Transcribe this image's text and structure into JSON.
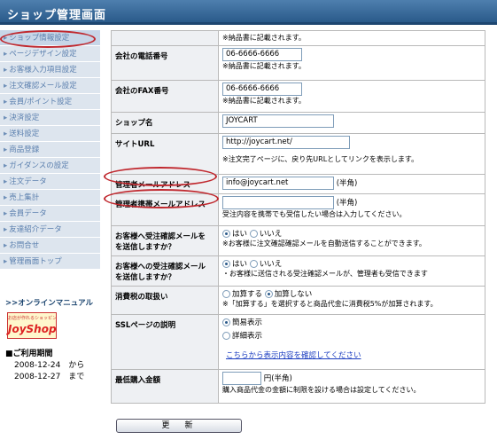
{
  "header": {
    "title": "ショップ管理画面"
  },
  "sidebar": {
    "items": [
      "ショップ情報設定",
      "ページデザイン設定",
      "お客様入力項目設定",
      "注文確認メール設定",
      "会員/ポイント設定",
      "決済設定",
      "送料設定",
      "商品登録",
      "ガイダンスの設定",
      "注文データ",
      "売上集計",
      "会員データ",
      "友達紹介データ",
      "お問合せ",
      "管理画面トップ"
    ]
  },
  "manual_link": ">>オンラインマニュアル",
  "logo": {
    "top": "お店が作れるショッピング",
    "main": "JoyShop"
  },
  "period": {
    "title": "■ご利用期間",
    "row1": "2008-12-24　から",
    "row2": "2008-12-27　まで"
  },
  "form": {
    "note_top": "※納品書に記載されます。",
    "phone": {
      "label": "会社の電話番号",
      "value": "06-6666-6666",
      "note": "※納品書に記載されます。"
    },
    "fax": {
      "label": "会社のFAX番号",
      "value": "06-6666-6666",
      "note": "※納品書に記載されます。"
    },
    "shop_name": {
      "label": "ショップ名",
      "value": "JOYCART"
    },
    "site_url": {
      "label": "サイトURL",
      "value": "http://joycart.net/",
      "note": "※注文完了ページに、戻り先URLとしてリンクを表示します。"
    },
    "admin_email": {
      "label": "管理者メールアドレス",
      "value": "info@joycart.net",
      "suffix": "(半角)"
    },
    "admin_mobile": {
      "label": "管理者携帯メールアドレス",
      "value": "",
      "suffix": "(半角)",
      "note": "受注内容を携帯でも受信したい場合は入力してください。"
    },
    "order_confirm": {
      "label1": "お客様へ受注確認メールを",
      "label2": "を送信しますか？",
      "yes": "はい",
      "no": "いいえ",
      "note": "※お客様に注文確認確認メールを自動送信することができます。"
    },
    "order_confirm2": {
      "label1": "お客様への受注確認メール",
      "label2": "を送信しますか？",
      "yes": "はい",
      "no": "いいえ",
      "note": "・お客様に送信される受注確認メールが、管理者も受信できます"
    },
    "tax": {
      "label": "消費税の取扱い",
      "opt1": "加算する",
      "opt2": "加算しない",
      "note": "※「加算する」を選択すると商品代金に消費税5%が加算されます。"
    },
    "ssl": {
      "label": "SSLページの説明",
      "opt1": "簡易表示",
      "opt2": "詳細表示",
      "link": "こちらから表示内容を確認してください"
    },
    "min_purchase": {
      "label": "最低購入金額",
      "value": "",
      "unit": "円(半角)",
      "note": "購入商品代金の金額に制限を設ける場合は設定してください。"
    }
  },
  "submit_label": "更　新"
}
